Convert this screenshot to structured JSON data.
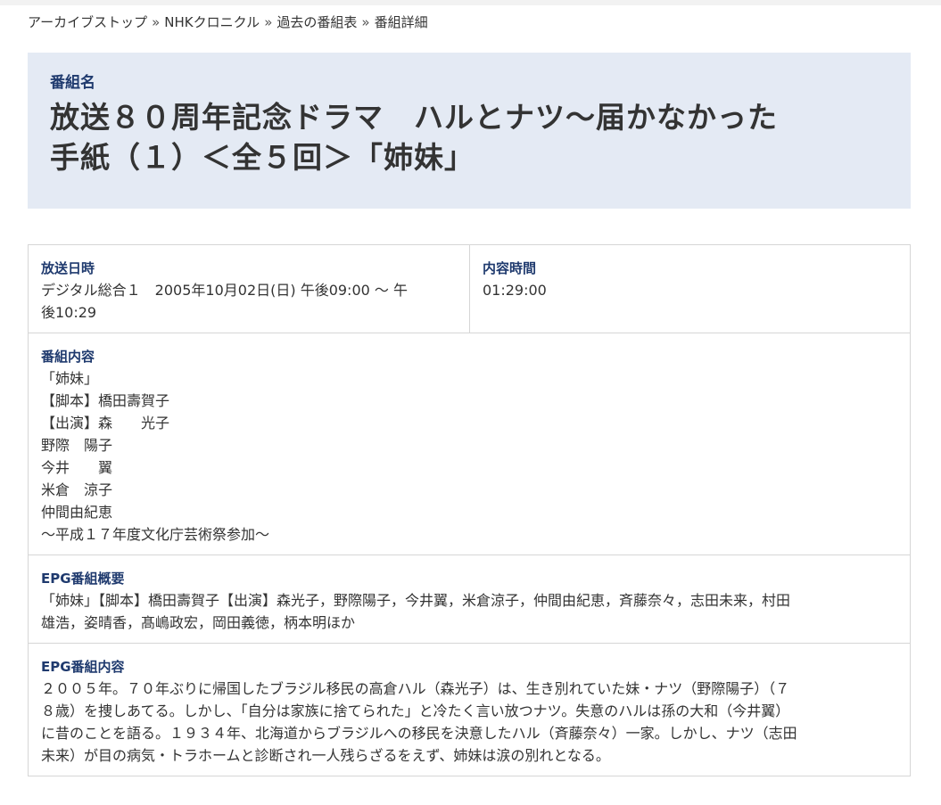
{
  "breadcrumb": {
    "items": [
      "アーカイブストップ",
      "NHKクロニクル",
      "過去の番組表",
      "番組詳細"
    ],
    "separator": "»"
  },
  "program": {
    "name_label": "番組名",
    "title_line1": "放送８０周年記念ドラマ　ハルとナツ～届かなかった",
    "title_line2": "手紙（１）＜全５回＞「姉妹」"
  },
  "broadcast": {
    "label": "放送日時",
    "line1": "デジタル総合１　2005年10月02日(日) 午後09:00 ～ 午",
    "line2": "後10:29"
  },
  "duration": {
    "label": "内容時間",
    "value": "01:29:00"
  },
  "content": {
    "label": "番組内容",
    "lines": [
      "「姉妹」",
      "【脚本】橋田壽賀子",
      "【出演】森　　光子",
      "野際　陽子",
      "今井　　翼",
      "米倉　涼子",
      "仲間由紀恵",
      "～平成１７年度文化庁芸術祭参加～"
    ]
  },
  "epg_summary": {
    "label": "EPG番組概要",
    "lines": [
      "「姉妹」【脚本】橋田壽賀子【出演】森光子，野際陽子，今井翼，米倉涼子，仲間由紀恵，斉藤奈々，志田未来，村田",
      "雄浩，姿晴香，髙嶋政宏，岡田義徳，柄本明ほか"
    ]
  },
  "epg_content": {
    "label": "EPG番組内容",
    "lines": [
      "２００５年。７０年ぶりに帰国したブラジル移民の高倉ハル（森光子）は、生き別れていた妹・ナツ（野際陽子）（７",
      "８歳）を捜しあてる。しかし、「自分は家族に捨てられた」と冷たく言い放つナツ。失意のハルは孫の大和（今井翼）",
      "に昔のことを語る。１９３４年、北海道からブラジルへの移民を決意したハル（斉藤奈々）一家。しかし、ナツ（志田",
      "未来）が目の病気・トラホームと診断され一人残らざるをえず、姉妹は涙の別れとなる。"
    ]
  }
}
